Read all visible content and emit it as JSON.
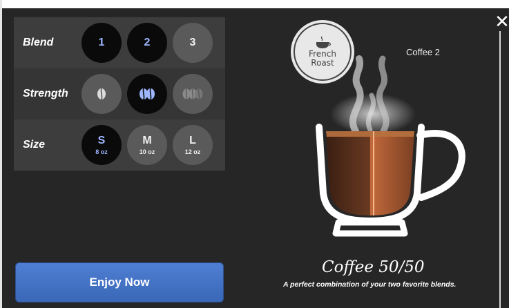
{
  "selector": {
    "blend": {
      "label": "Blend",
      "options": [
        "1",
        "2",
        "3"
      ],
      "selected": [
        "1",
        "2"
      ]
    },
    "strength": {
      "label": "Strength",
      "options_icons": [
        "bean-single-icon",
        "bean-double-icon",
        "bean-triple-icon"
      ],
      "selected_index": 1
    },
    "size": {
      "label": "Size",
      "options": [
        {
          "label": "S",
          "sub": "8 oz"
        },
        {
          "label": "M",
          "sub": "10 oz"
        },
        {
          "label": "L",
          "sub": "12 oz"
        }
      ],
      "selected_index": 0
    }
  },
  "action": {
    "enjoy_label": "Enjoy Now"
  },
  "preview": {
    "badge_line1": "French",
    "badge_line2": "Roast",
    "coffee_label": "Coffee 2",
    "title": "Coffee 50/50",
    "description": "A perfect combination of your two favorite blends."
  },
  "colors": {
    "background": "#262626",
    "button": "#4472c4",
    "selected_circle": "#0a0a0a",
    "accent_blue": "#9fb7ff"
  }
}
